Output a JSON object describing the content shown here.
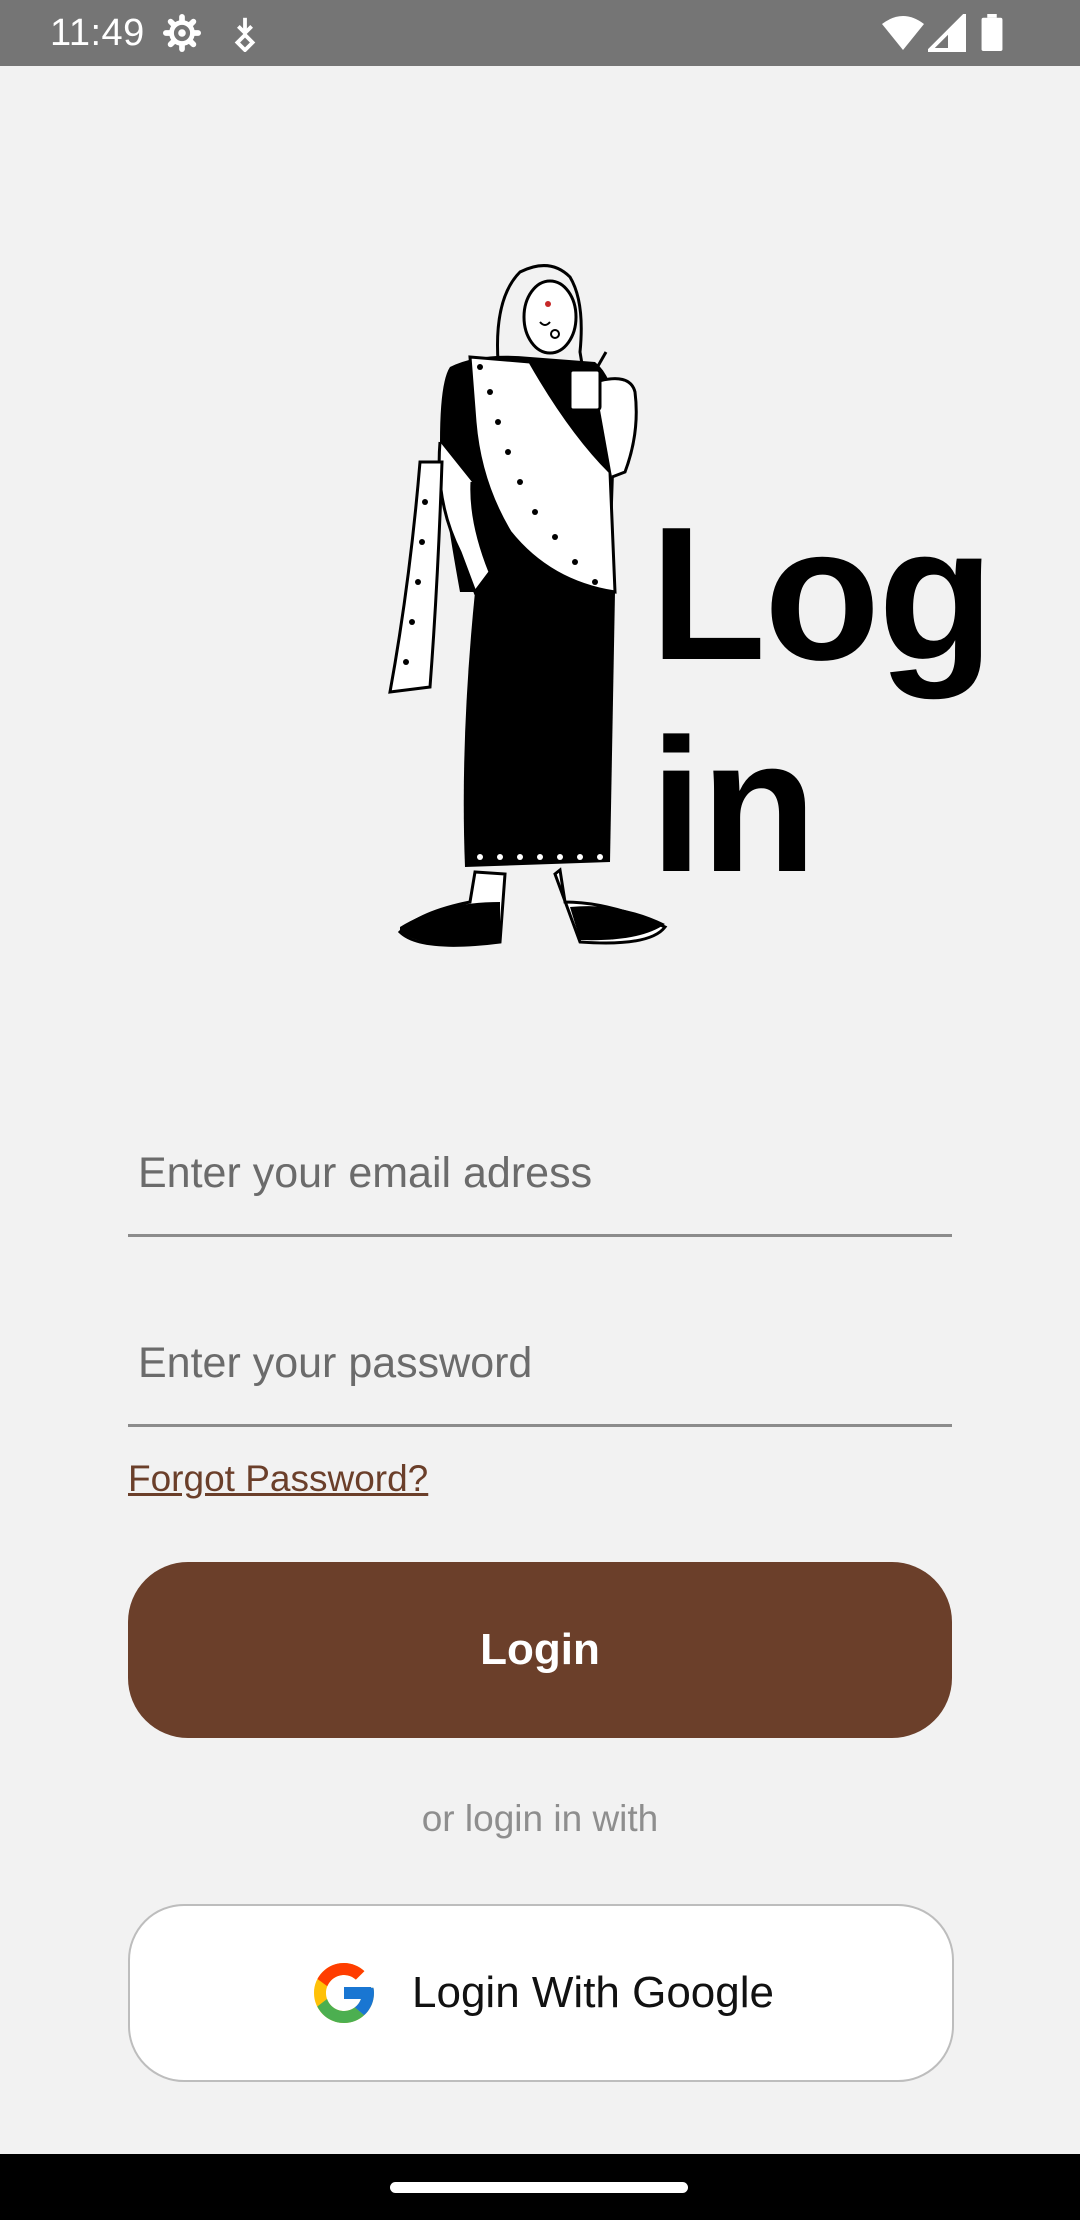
{
  "status_bar": {
    "time": "11:49",
    "icons": [
      "settings-icon",
      "download-icon",
      "wifi-icon",
      "signal-icon",
      "battery-icon"
    ]
  },
  "hero": {
    "title_line1": "Log",
    "title_line2": "in",
    "illustration": "woman-holding-cup-illustration"
  },
  "form": {
    "email_placeholder": "Enter your email adress",
    "email_value": "",
    "password_placeholder": "Enter your password",
    "password_value": "",
    "forgot_label": "Forgot Password?",
    "login_label": "Login",
    "divider_text": "or login in with",
    "google_label": "Login With Google"
  },
  "colors": {
    "accent": "#6b3f2a",
    "background": "#f2f2f2",
    "status_bar": "#757575"
  }
}
